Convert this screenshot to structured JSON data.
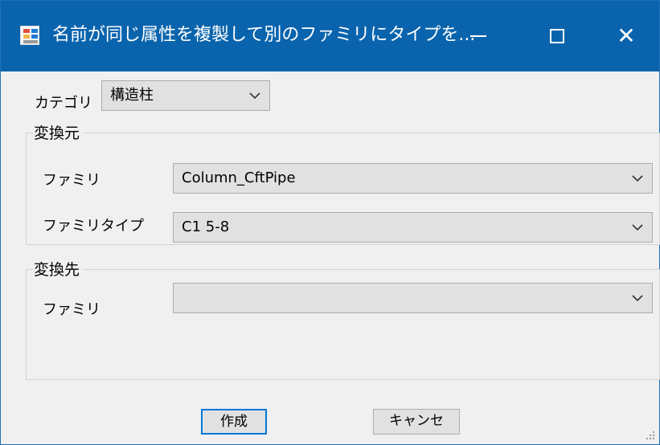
{
  "window": {
    "title": "名前が同じ属性を複製して別のファミリにタイプを..."
  },
  "category": {
    "label": "カテゴリ",
    "value": "構造柱"
  },
  "source_group": {
    "title": "変換元",
    "family_label": "ファミリ",
    "family_value": "Column_CftPipe",
    "type_label": "ファミリタイプ",
    "type_value": "C1 5-8"
  },
  "target_group": {
    "title": "変換先",
    "family_label": "ファミリ",
    "family_value": ""
  },
  "buttons": {
    "create": "作成",
    "cancel": "キャンセ"
  },
  "colors": {
    "titlebar": "#0a64ad",
    "window_bg": "#f0f0f0",
    "control_bg": "#e1e1e1",
    "focus_border": "#0078d7"
  }
}
